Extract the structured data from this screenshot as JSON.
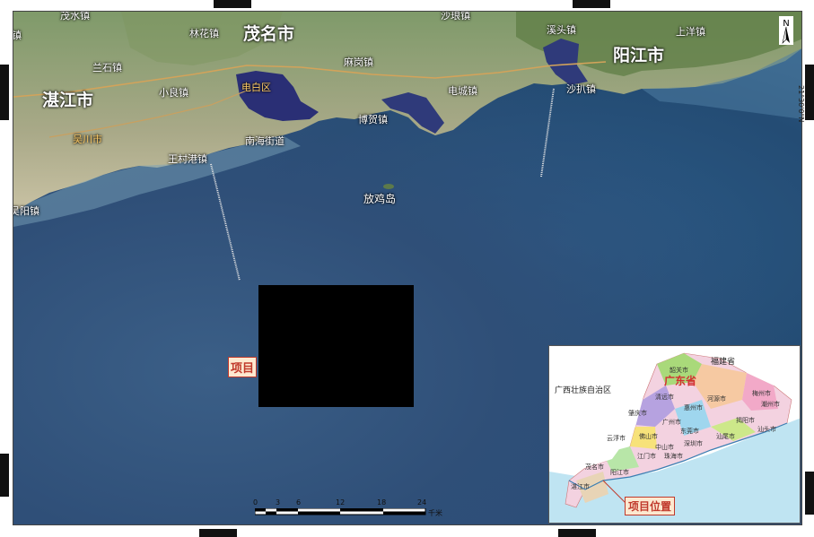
{
  "map": {
    "cities": {
      "maoming": "茂名市",
      "zhanjiang": "湛江市",
      "yangjiang": "阳江市"
    },
    "counties": {
      "dianbai": "电白区",
      "wuchuan": "吴川市"
    },
    "towns": {
      "north_edge": "茂水镇",
      "north_edge2": "沙琅镇",
      "left_edge": "镇",
      "linhua": "林花镇",
      "lanshi": "兰石镇",
      "xiaoliang": "小良镇",
      "nanhai": "南海街道",
      "wangcun": "王村港镇",
      "madou": "麻岗镇",
      "bohe": "博贺镇",
      "dianc": "电城镇",
      "yuedong": "溪头镇",
      "shaba": "沙扒镇",
      "shangyang": "上洋镇",
      "jiaoyang": "吴阳镇"
    },
    "island": "放鸡岛",
    "project_label": "项目",
    "scale": {
      "ticks": [
        "0",
        "3",
        "6",
        "12",
        "18",
        "24"
      ],
      "unit": "千米"
    },
    "north": "N",
    "lat_label": "21°30'0\"N"
  },
  "inset": {
    "province": "广东省",
    "neighbors": {
      "fujian": "福建省",
      "guangxi": "广西壮族自治区"
    },
    "cities": [
      "韶关市",
      "清远市",
      "肇庆市",
      "河源市",
      "梅州市",
      "潮州市",
      "惠州市",
      "广州市",
      "揭阳市",
      "汕头市",
      "云浮市",
      "佛山市",
      "东莞市",
      "汕尾市",
      "深圳市",
      "中山市",
      "江门市",
      "阳江市",
      "茂名市",
      "湛江市",
      "珠海市"
    ],
    "project_label": "项目位置"
  }
}
